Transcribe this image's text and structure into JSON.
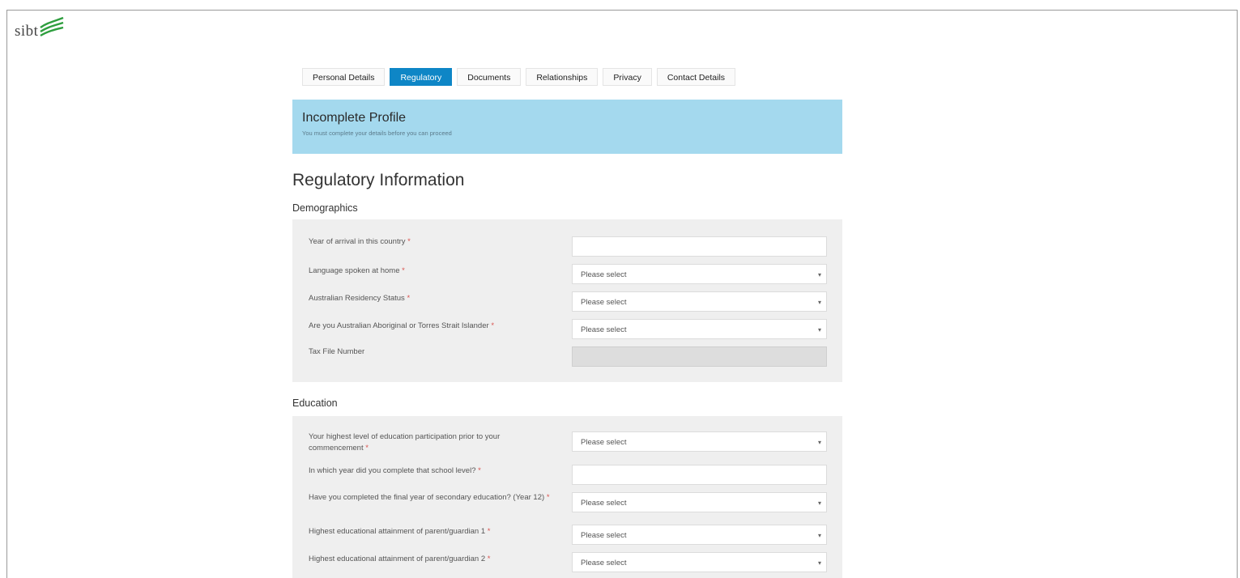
{
  "logo": {
    "text": "sibt"
  },
  "tabs": [
    {
      "label": "Personal Details",
      "active": false
    },
    {
      "label": "Regulatory",
      "active": true
    },
    {
      "label": "Documents",
      "active": false
    },
    {
      "label": "Relationships",
      "active": false
    },
    {
      "label": "Privacy",
      "active": false
    },
    {
      "label": "Contact Details",
      "active": false
    }
  ],
  "alert": {
    "title": "Incomplete Profile",
    "message": "You must complete your details before you can proceed"
  },
  "page_title": "Regulatory Information",
  "demographics": {
    "title": "Demographics",
    "fields": [
      {
        "label": "Year of arrival in this country",
        "required": "*",
        "type": "text",
        "value": ""
      },
      {
        "label": "Language spoken at home",
        "required": "*",
        "type": "select",
        "value": "Please select"
      },
      {
        "label": "Australian Residency Status",
        "required": "*",
        "type": "select",
        "value": "Please select"
      },
      {
        "label": "Are you Australian Aboriginal or Torres Strait Islander",
        "required": "*",
        "type": "select",
        "value": "Please select"
      },
      {
        "label": "Tax File Number",
        "required": "",
        "type": "disabled",
        "value": ""
      }
    ]
  },
  "education": {
    "title": "Education",
    "fields": [
      {
        "label": "Your highest level of education participation prior to your commencement",
        "required": "*",
        "type": "select",
        "value": "Please select"
      },
      {
        "label": "In which year did you complete that school level?",
        "required": "*",
        "type": "text",
        "value": ""
      },
      {
        "label": "Have you completed the final year of secondary education? (Year 12)",
        "required": "*",
        "type": "select",
        "value": "Please select"
      },
      {
        "label": "Highest educational attainment of parent/guardian 1",
        "required": "*",
        "type": "select",
        "value": "Please select"
      },
      {
        "label": "Highest educational attainment of parent/guardian 2",
        "required": "*",
        "type": "select",
        "value": "Please select"
      }
    ]
  },
  "colors": {
    "accent": "#0e86c6",
    "alert_bg": "#a4d9ee",
    "panel_bg": "#efefef",
    "required": "#d9534f",
    "logo_green": "#2e9e3e"
  }
}
